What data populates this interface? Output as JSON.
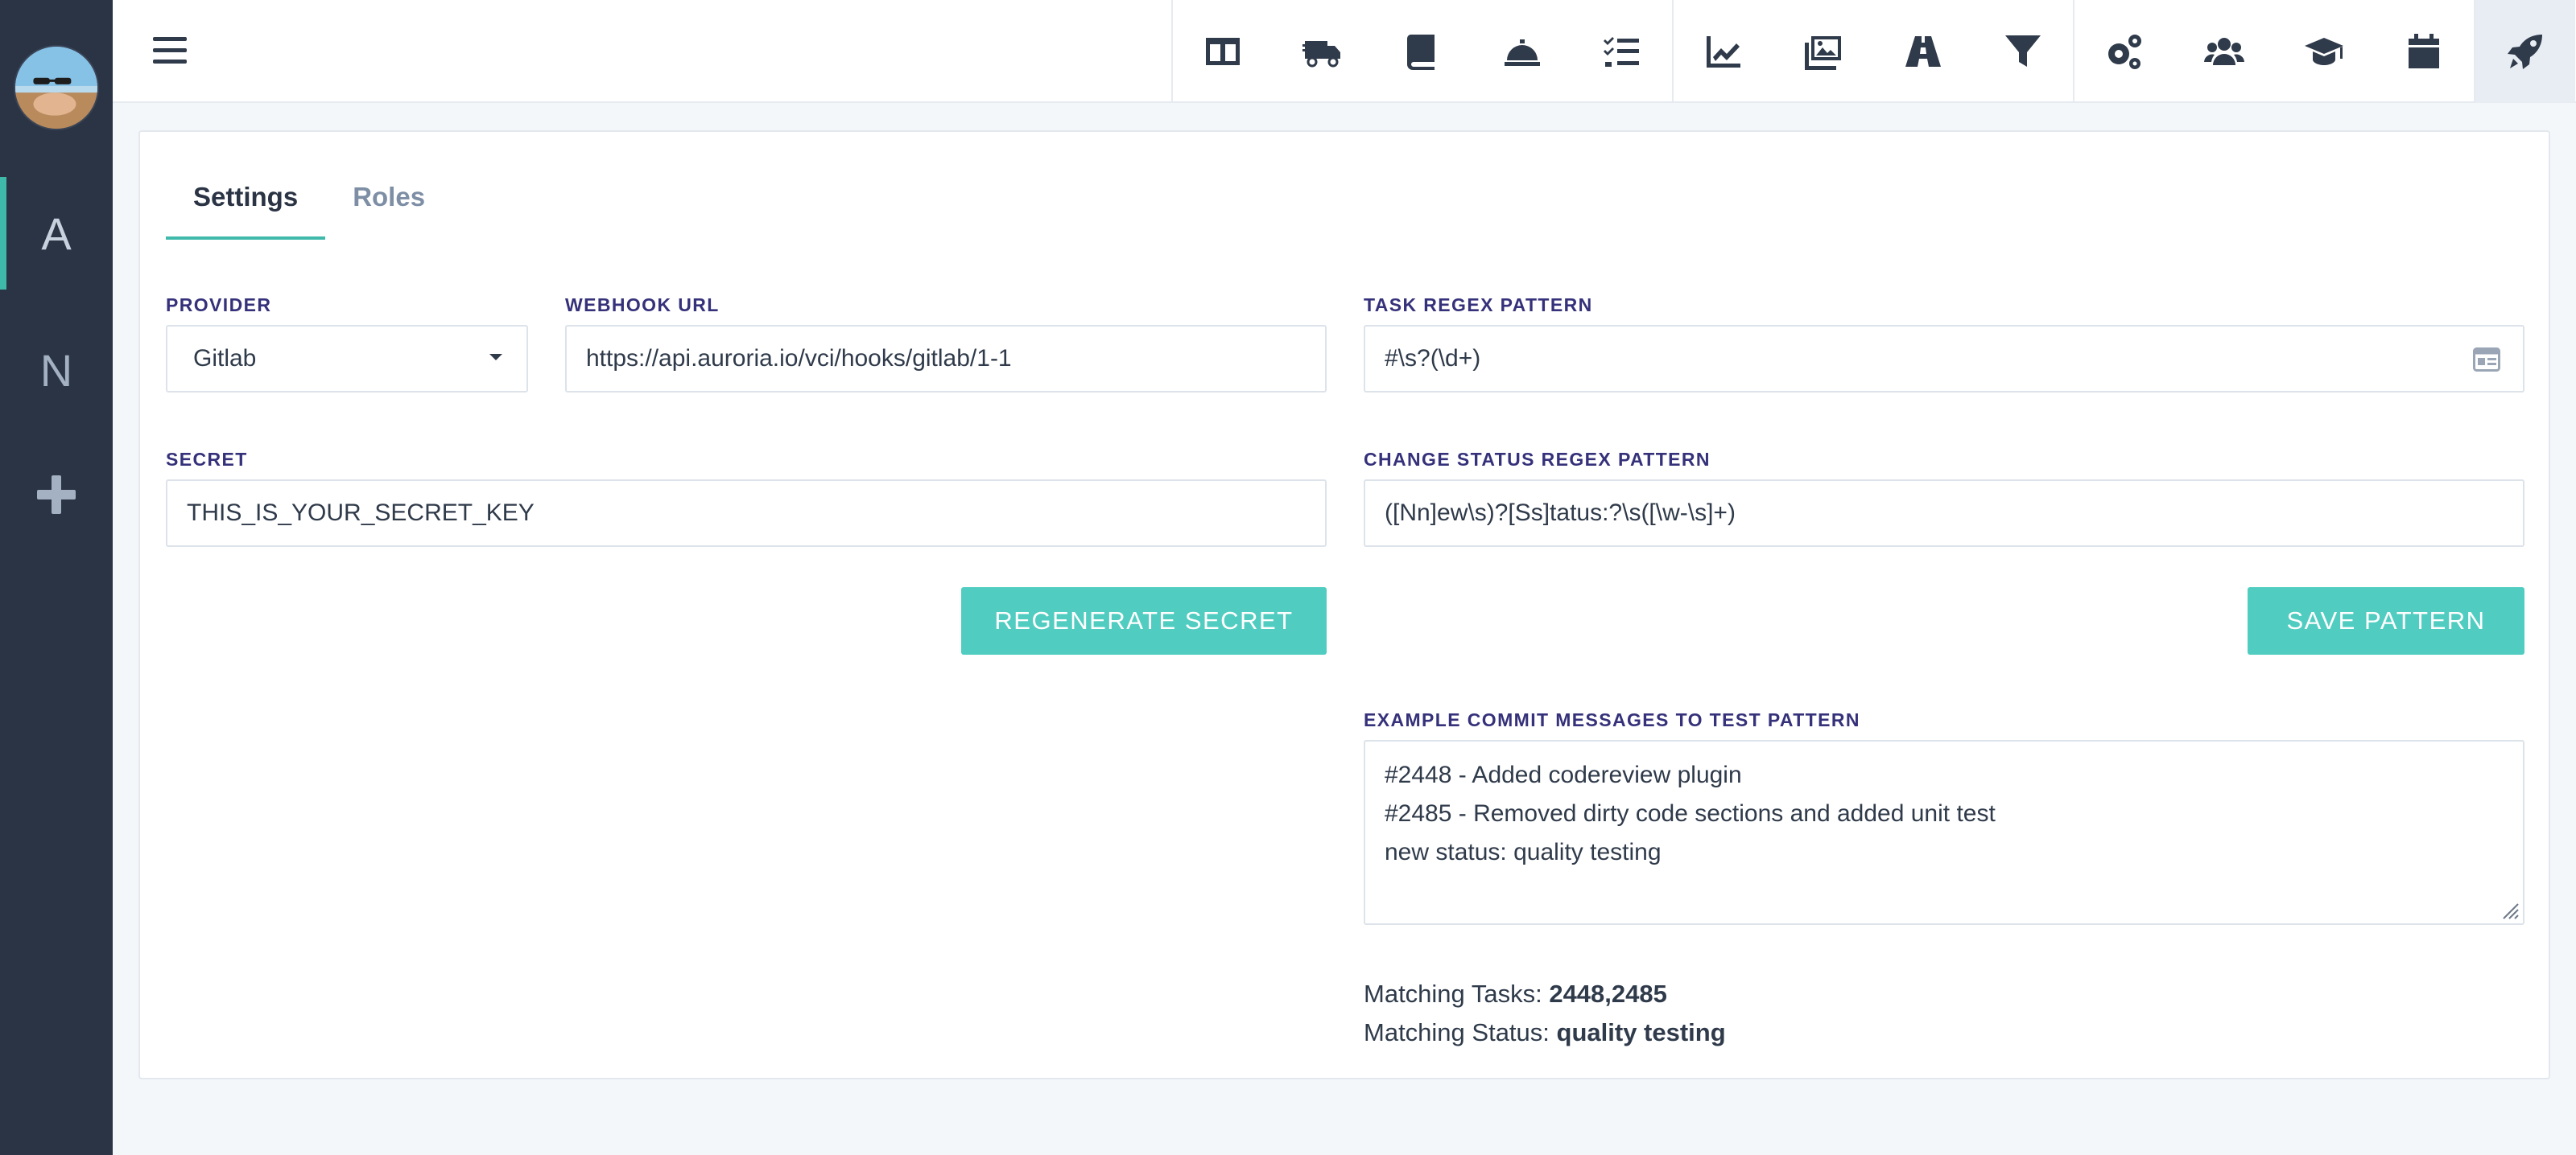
{
  "sidebar": {
    "workspaces": [
      {
        "label": "A",
        "active": true
      },
      {
        "label": "N",
        "active": false
      }
    ],
    "add_label": "+"
  },
  "topbar": {
    "tools": [
      {
        "icon": "columns-icon"
      },
      {
        "icon": "truck-icon"
      },
      {
        "icon": "book-icon"
      },
      {
        "icon": "concierge-bell-icon"
      },
      {
        "icon": "tasks-icon"
      },
      {
        "icon": "chart-line-icon"
      },
      {
        "icon": "images-icon"
      },
      {
        "icon": "road-icon"
      },
      {
        "icon": "filter-icon"
      },
      {
        "icon": "cogs-icon"
      },
      {
        "icon": "users-icon"
      },
      {
        "icon": "graduation-cap-icon"
      },
      {
        "icon": "calendar-icon"
      },
      {
        "icon": "rocket-icon",
        "active": true
      }
    ]
  },
  "tabs": [
    {
      "label": "Settings",
      "active": true
    },
    {
      "label": "Roles",
      "active": false
    }
  ],
  "form": {
    "provider_label": "PROVIDER",
    "provider_value": "Gitlab",
    "webhook_label": "WEBHOOK URL",
    "webhook_value": "https://api.auroria.io/vci/hooks/gitlab/1-1",
    "secret_label": "SECRET",
    "secret_value": "THIS_IS_YOUR_SECRET_KEY",
    "regenerate_label": "REGENERATE SECRET",
    "task_regex_label": "TASK REGEX PATTERN",
    "task_regex_value": "#\\s?(\\d+)",
    "status_regex_label": "CHANGE STATUS REGEX PATTERN",
    "status_regex_value": "([Nn]ew\\s)?[Ss]tatus:?\\s([\\w-\\s]+)",
    "save_label": "SAVE PATTERN",
    "examples_label": "EXAMPLE COMMIT MESSAGES TO TEST PATTERN",
    "examples_lines": [
      "#2448 - Added codereview plugin",
      "#2485 - Removed dirty code sections and added unit test",
      "new status: quality testing"
    ]
  },
  "results": {
    "tasks_label": "Matching Tasks:",
    "tasks_value": "2448,2485",
    "status_label": "Matching Status:",
    "status_value": "quality testing"
  },
  "colors": {
    "sidebar_bg": "#2b3445",
    "accent": "#3fb9aa",
    "button": "#50cdc0",
    "label": "#35317a"
  }
}
